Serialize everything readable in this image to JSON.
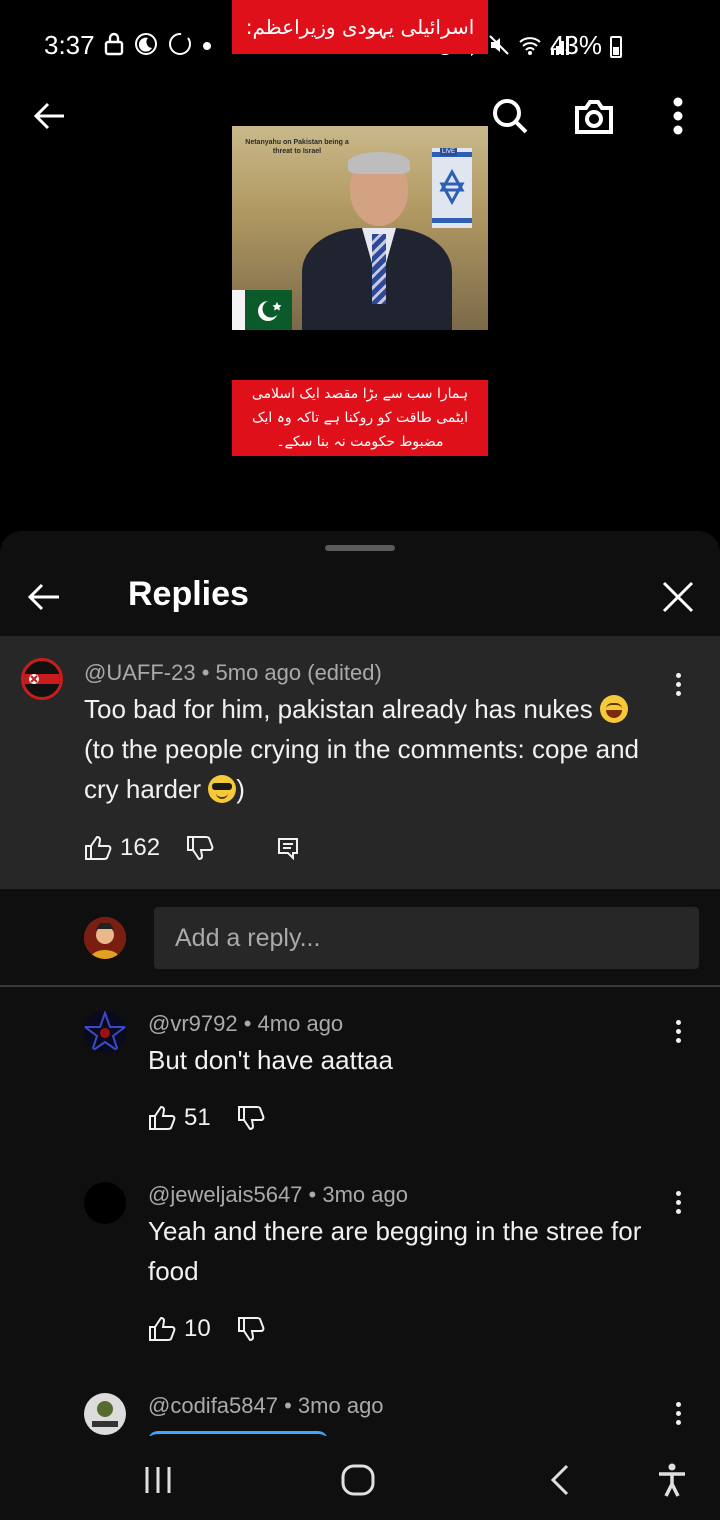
{
  "status_bar": {
    "time": "3:37",
    "battery": "43%"
  },
  "video": {
    "top_banner": "اسرائیلی یہودی وزیراعظم:",
    "frame_caption": "Netanyahu on Pakistan being a threat to Israel",
    "live_tag": "LIVE",
    "urdu_caption_lines": [
      "ہمارا سب سے بڑا مقصد ایک اسلامی",
      "ایٹمی طاقت کو روکنا ہے تاکہ وہ ایک",
      "مضبوط حکومت نہ بنا سکے۔"
    ]
  },
  "panel": {
    "title": "Replies"
  },
  "parent_comment": {
    "author": "@UAFF-23",
    "time": "5mo ago (edited)",
    "text_line1": "Too bad for him, pakistan already has nukes",
    "text_line2": "(to the people crying in the comments: cope and",
    "text_line3": "cry harder",
    "text_line3_end": ")",
    "likes": "162"
  },
  "reply_input": {
    "placeholder": "Add a reply..."
  },
  "replies": [
    {
      "author": "@vr9792",
      "time": "4mo ago",
      "text_line1": "But don't have aattaa",
      "text_line2": "",
      "likes": "51"
    },
    {
      "author": "@jeweljais5647",
      "time": "3mo ago",
      "text_line1": "Yeah and there are begging in the stree for",
      "text_line2": "food",
      "likes": "10"
    },
    {
      "author": "@codifa5847",
      "time": "3mo ago",
      "text_line1": "",
      "text_line2": "",
      "likes": ""
    }
  ],
  "colors": {
    "background": "#0f0f0f",
    "highlight_comment": "#272727",
    "meta_text": "#aaaaaa",
    "banner_red": "#e0101a"
  }
}
